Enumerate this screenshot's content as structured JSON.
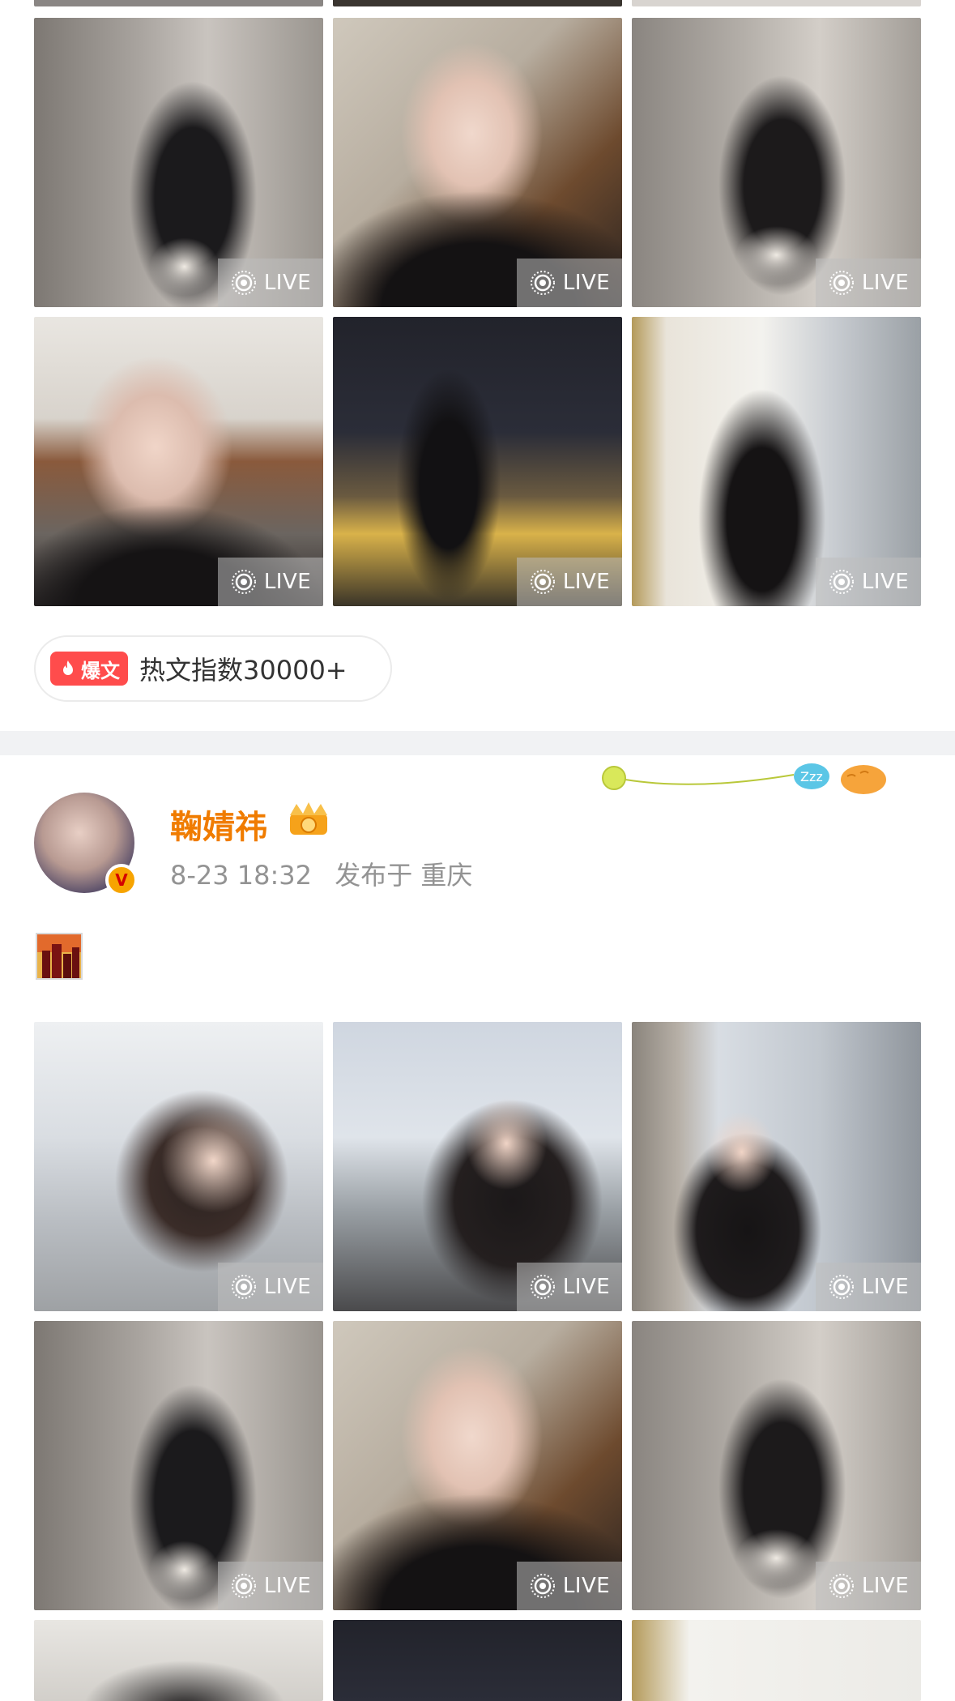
{
  "live_label": "LIVE",
  "hot": {
    "badge_label": "爆文",
    "text": "热文指数30000+"
  },
  "post": {
    "author_name": "鞠婧祎",
    "time": "8-23 18:32",
    "location": "发布于 重庆",
    "verified_badge": "V"
  },
  "pendant": {
    "sleep_text": "Zzz"
  },
  "colors": {
    "accent_orange": "#f07c00",
    "hot_red": "#ff4c4c",
    "divider_grey": "#f1f2f4",
    "meta_grey": "#939393"
  },
  "photos_top": [
    {
      "scene": "hallway"
    },
    {
      "scene": "marble-closeup"
    },
    {
      "scene": "hallway-sitting"
    },
    {
      "scene": "balcony-closeup"
    },
    {
      "scene": "night-city"
    },
    {
      "scene": "window-city"
    }
  ],
  "photos_bottom": [
    {
      "scene": "city-portrait"
    },
    {
      "scene": "window-lean"
    },
    {
      "scene": "window-city-standing"
    },
    {
      "scene": "hallway"
    },
    {
      "scene": "marble-closeup"
    },
    {
      "scene": "hallway-sitting"
    }
  ]
}
